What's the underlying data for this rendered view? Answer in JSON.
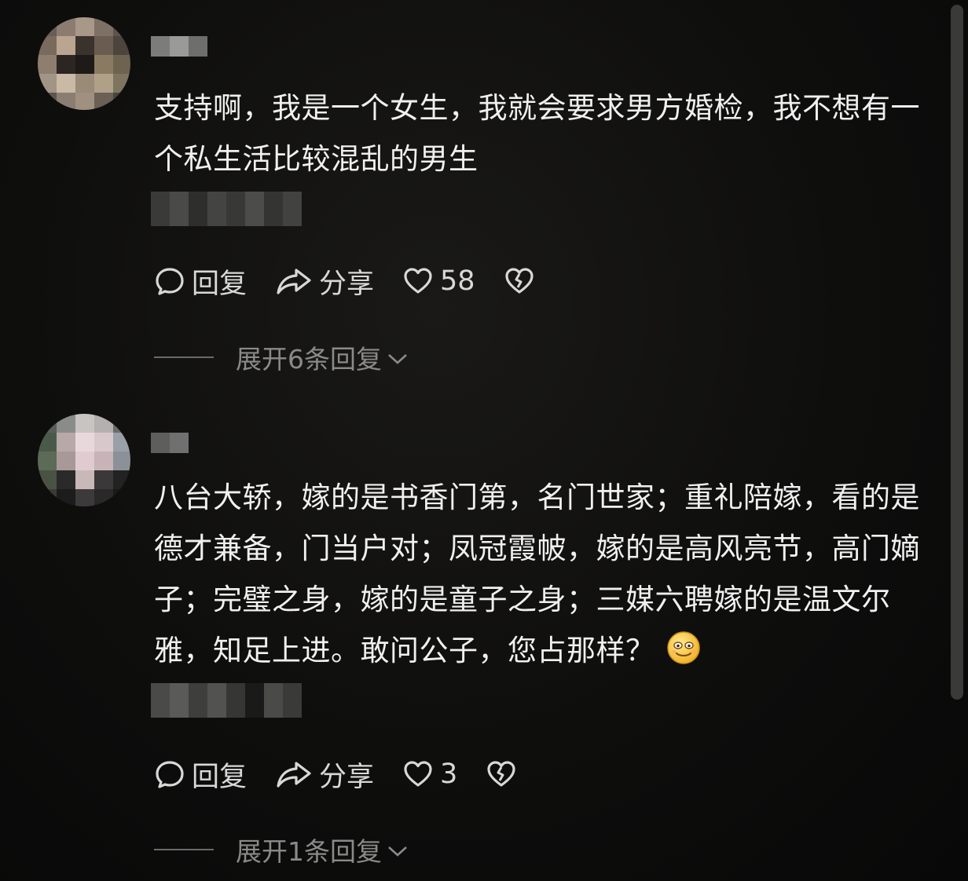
{
  "colors": {
    "background": "#0b0b0a",
    "text": "#f0f0f0",
    "action_text": "#d8d8d8",
    "muted": "#8a8a88"
  },
  "comments": [
    {
      "text": "支持啊，我是一个女生，我就会要求男方婚检，我不想有一个私生活比较混乱的男生",
      "actions": {
        "reply_label": "回复",
        "share_label": "分享",
        "like_count": "58"
      },
      "expand_label": "展开6条回复"
    },
    {
      "text": "八台大轿，嫁的是书香门第，名门世家；重礼陪嫁，看的是德才兼备，门当户对；凤冠霞帔，嫁的是高风亮节，高门嫡子；完璧之身，嫁的是童子之身；三媒六聘嫁的是温文尔雅，知足上进。敢问公子，您占那样？",
      "emoji": "smiling-face-emoji",
      "actions": {
        "reply_label": "回复",
        "share_label": "分享",
        "like_count": "3"
      },
      "expand_label": "展开1条回复"
    }
  ],
  "icons": {
    "reply": "comment-bubble-icon",
    "share": "share-arrow-icon",
    "like": "heart-icon",
    "dislike": "broken-heart-icon",
    "expand": "chevron-down-icon"
  }
}
